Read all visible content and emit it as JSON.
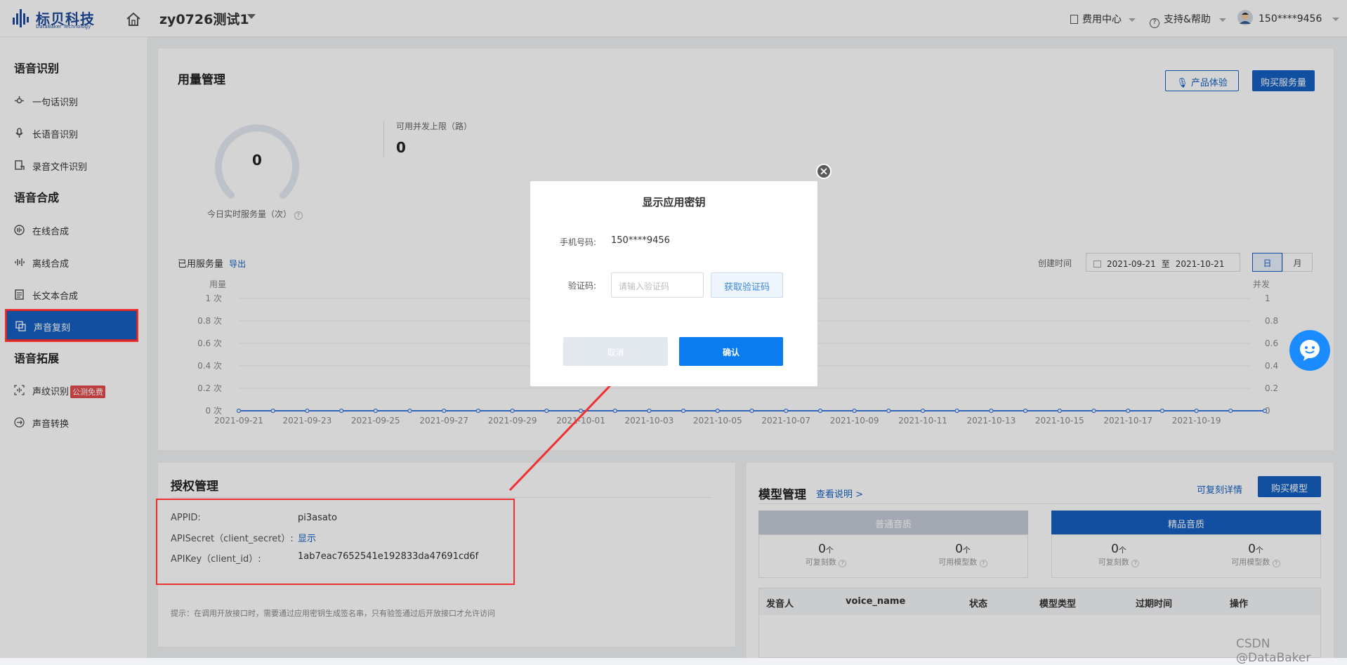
{
  "header": {
    "logo_name": "标贝科技",
    "logo_sub": "DataBaker Technology",
    "app_title": "zy0726测试1",
    "nav": [
      "费用中心",
      "支持&帮助"
    ],
    "user": "150****9456"
  },
  "sidebar": {
    "groups": [
      {
        "title": "语音识别",
        "items": [
          {
            "label": "一句话识别"
          },
          {
            "label": "长语音识别"
          },
          {
            "label": "录音文件识别"
          }
        ]
      },
      {
        "title": "语音合成",
        "items": [
          {
            "label": "在线合成"
          },
          {
            "label": "离线合成"
          },
          {
            "label": "长文本合成"
          },
          {
            "label": "声音复刻"
          }
        ]
      },
      {
        "title": "语音拓展",
        "items": [
          {
            "label": "声纹识别",
            "badge": "公测免费"
          },
          {
            "label": "声音转换"
          }
        ]
      }
    ]
  },
  "usage": {
    "title": "用量管理",
    "btn_trial": "产品体验",
    "btn_buy": "购买服务量",
    "gauge_value": "0",
    "gauge_label": "今日实时服务量（次）",
    "concurrency_label": "可用并发上限（路）",
    "concurrency_value": "0",
    "used_label": "已用服务量",
    "export": "导出",
    "create_time_label": "创建时间",
    "date_from": "2021-09-21",
    "date_sep": "至",
    "date_to": "2021-10-21",
    "toggle_day": "日",
    "toggle_month": "月"
  },
  "chart_data": {
    "type": "line",
    "ylabel": "用量",
    "y2label": "并发",
    "y_ticks": [
      "0 次",
      "0.2 次",
      "0.4 次",
      "0.6 次",
      "0.8 次",
      "1 次"
    ],
    "y2_ticks": [
      "0",
      "0.2",
      "0.4",
      "0.6",
      "0.8",
      "1"
    ],
    "ylim": [
      0,
      1
    ],
    "x_ticks": [
      "2021-09-21",
      "2021-09-23",
      "2021-09-25",
      "2021-09-27",
      "2021-09-29",
      "2021-10-01",
      "2021-10-03",
      "2021-10-05",
      "2021-10-07",
      "2021-10-09",
      "2021-10-11",
      "2021-10-13",
      "2021-10-15",
      "2021-10-17",
      "2021-10-19"
    ],
    "x": [
      "2021-09-21",
      "2021-09-22",
      "2021-09-23",
      "2021-09-24",
      "2021-09-25",
      "2021-09-26",
      "2021-09-27",
      "2021-09-28",
      "2021-09-29",
      "2021-09-30",
      "2021-10-01",
      "2021-10-02",
      "2021-10-03",
      "2021-10-04",
      "2021-10-05",
      "2021-10-06",
      "2021-10-07",
      "2021-10-08",
      "2021-10-09",
      "2021-10-10",
      "2021-10-11",
      "2021-10-12",
      "2021-10-13",
      "2021-10-14",
      "2021-10-15",
      "2021-10-16",
      "2021-10-17",
      "2021-10-18",
      "2021-10-19",
      "2021-10-20",
      "2021-10-21"
    ],
    "series": [
      {
        "values": [
          0,
          0,
          0,
          0,
          0,
          0,
          0,
          0,
          0,
          0,
          0,
          0,
          0,
          0,
          0,
          0,
          0,
          0,
          0,
          0,
          0,
          0,
          0,
          0,
          0,
          0,
          0,
          0,
          0,
          0,
          0
        ]
      }
    ],
    "grid": true,
    "colors": {
      "line": "#3a7be0"
    }
  },
  "auth": {
    "title": "授权管理",
    "rows": [
      {
        "key": "APPID:",
        "value": "pi3asato"
      },
      {
        "key": "APISecret（client_secret）:",
        "value": "显示"
      },
      {
        "key": "APIKey（client_id）:",
        "value": "1ab7eac7652541e192833da47691cd6f"
      }
    ],
    "tip": "提示：在调用开放接口时，需要通过应用密钥生成签名串，只有验签通过后开放接口才允许访问"
  },
  "models": {
    "title": "模型管理",
    "help_link": "查看说明 >",
    "detail_link": "可复刻详情",
    "buy_btn": "购买模型",
    "tab_normal": "普通音质",
    "tab_premium": "精品音质",
    "stat_unit": "个",
    "stats": [
      {
        "value": "0",
        "label": "可复刻数"
      },
      {
        "value": "0",
        "label": "可用模型数"
      },
      {
        "value": "0",
        "label": "可复刻数"
      },
      {
        "value": "0",
        "label": "可用模型数"
      }
    ],
    "columns": [
      "发音人",
      "voice_name",
      "状态",
      "模型类型",
      "过期时间",
      "操作"
    ]
  },
  "modal": {
    "title": "显示应用密钥",
    "phone_label": "手机号码:",
    "phone_value": "150****9456",
    "code_label": "验证码:",
    "code_placeholder": "请输入验证码",
    "get_code": "获取验证码",
    "cancel": "取消",
    "confirm": "确认"
  },
  "watermark": "CSDN @DataBaker",
  "colors": {
    "primary": "#1560c2",
    "accent": "#0a7cf0",
    "annotation": "#f03030"
  }
}
